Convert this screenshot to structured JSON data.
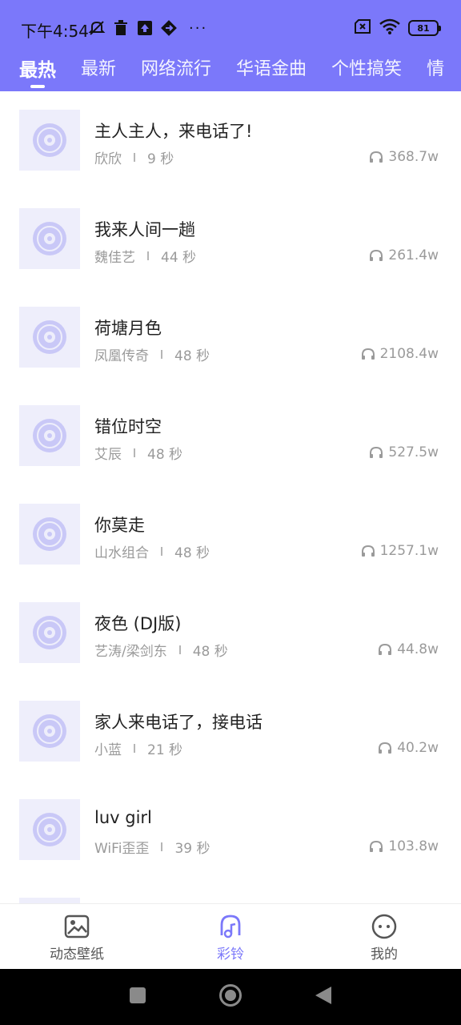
{
  "status_bar": {
    "time": "下午4:54",
    "more": "···",
    "battery": "81"
  },
  "tabs": [
    {
      "label": "最热",
      "active": true
    },
    {
      "label": "最新",
      "active": false
    },
    {
      "label": "网络流行",
      "active": false
    },
    {
      "label": "华语金曲",
      "active": false
    },
    {
      "label": "个性搞笑",
      "active": false
    },
    {
      "label": "情",
      "active": false
    }
  ],
  "songs": [
    {
      "title": "主人主人，来电话了!",
      "artist": "欣欣",
      "duration": "9 秒",
      "plays": "368.7w"
    },
    {
      "title": "我来人间一趟",
      "artist": "魏佳艺",
      "duration": "44 秒",
      "plays": "261.4w"
    },
    {
      "title": "荷塘月色",
      "artist": "凤凰传奇",
      "duration": "48 秒",
      "plays": "2108.4w"
    },
    {
      "title": "错位时空",
      "artist": "艾辰",
      "duration": "48 秒",
      "plays": "527.5w"
    },
    {
      "title": "你莫走",
      "artist": "山水组合",
      "duration": "48 秒",
      "plays": "1257.1w"
    },
    {
      "title": "夜色 (DJ版)",
      "artist": "艺涛/梁剑东",
      "duration": "48 秒",
      "plays": "44.8w"
    },
    {
      "title": "家人来电话了，接电话",
      "artist": "小蓝",
      "duration": "21 秒",
      "plays": "40.2w"
    },
    {
      "title": "luv girl",
      "artist": "WiFi歪歪",
      "duration": "39 秒",
      "plays": "103.8w"
    }
  ],
  "bottom_nav": [
    {
      "label": "动态壁纸",
      "icon": "image-icon",
      "active": false
    },
    {
      "label": "彩铃",
      "icon": "ringtone-bell-icon",
      "active": true
    },
    {
      "label": "我的",
      "icon": "face-icon",
      "active": false
    }
  ],
  "colors": {
    "accent": "#7b78fa",
    "thumb_bg": "#eeeefb",
    "disc": "#c9c8f7"
  }
}
